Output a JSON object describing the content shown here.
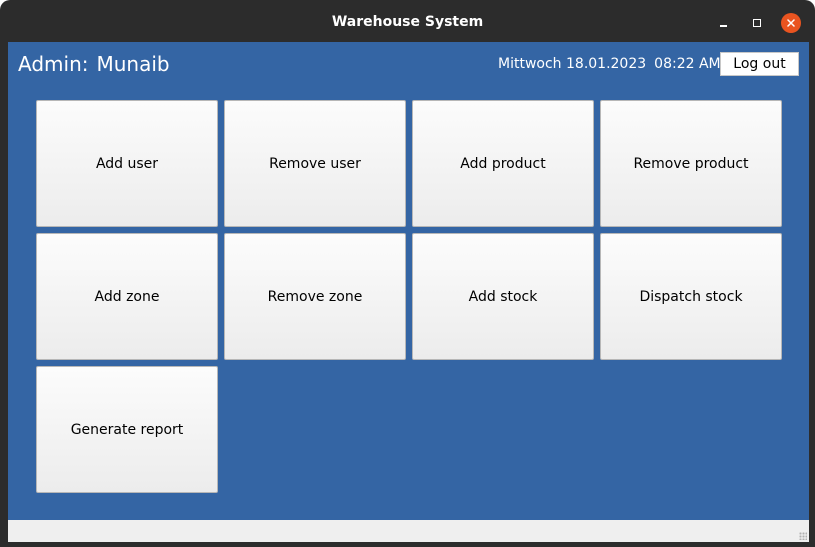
{
  "window": {
    "title": "Warehouse System"
  },
  "header": {
    "admin_label": "Admin:",
    "admin_name": "Munaib",
    "weekday": "Mittwoch",
    "date": "18.01.2023",
    "time": "08:22 AM",
    "logout_label": "Log out"
  },
  "actions": [
    "Add user",
    "Remove user",
    "Add product",
    "Remove product",
    "Add zone",
    "Remove zone",
    "Add stock",
    "Dispatch stock",
    "Generate report"
  ],
  "colors": {
    "background": "#3465a4",
    "titlebar": "#2c2c2c",
    "close_button": "#e95420"
  }
}
